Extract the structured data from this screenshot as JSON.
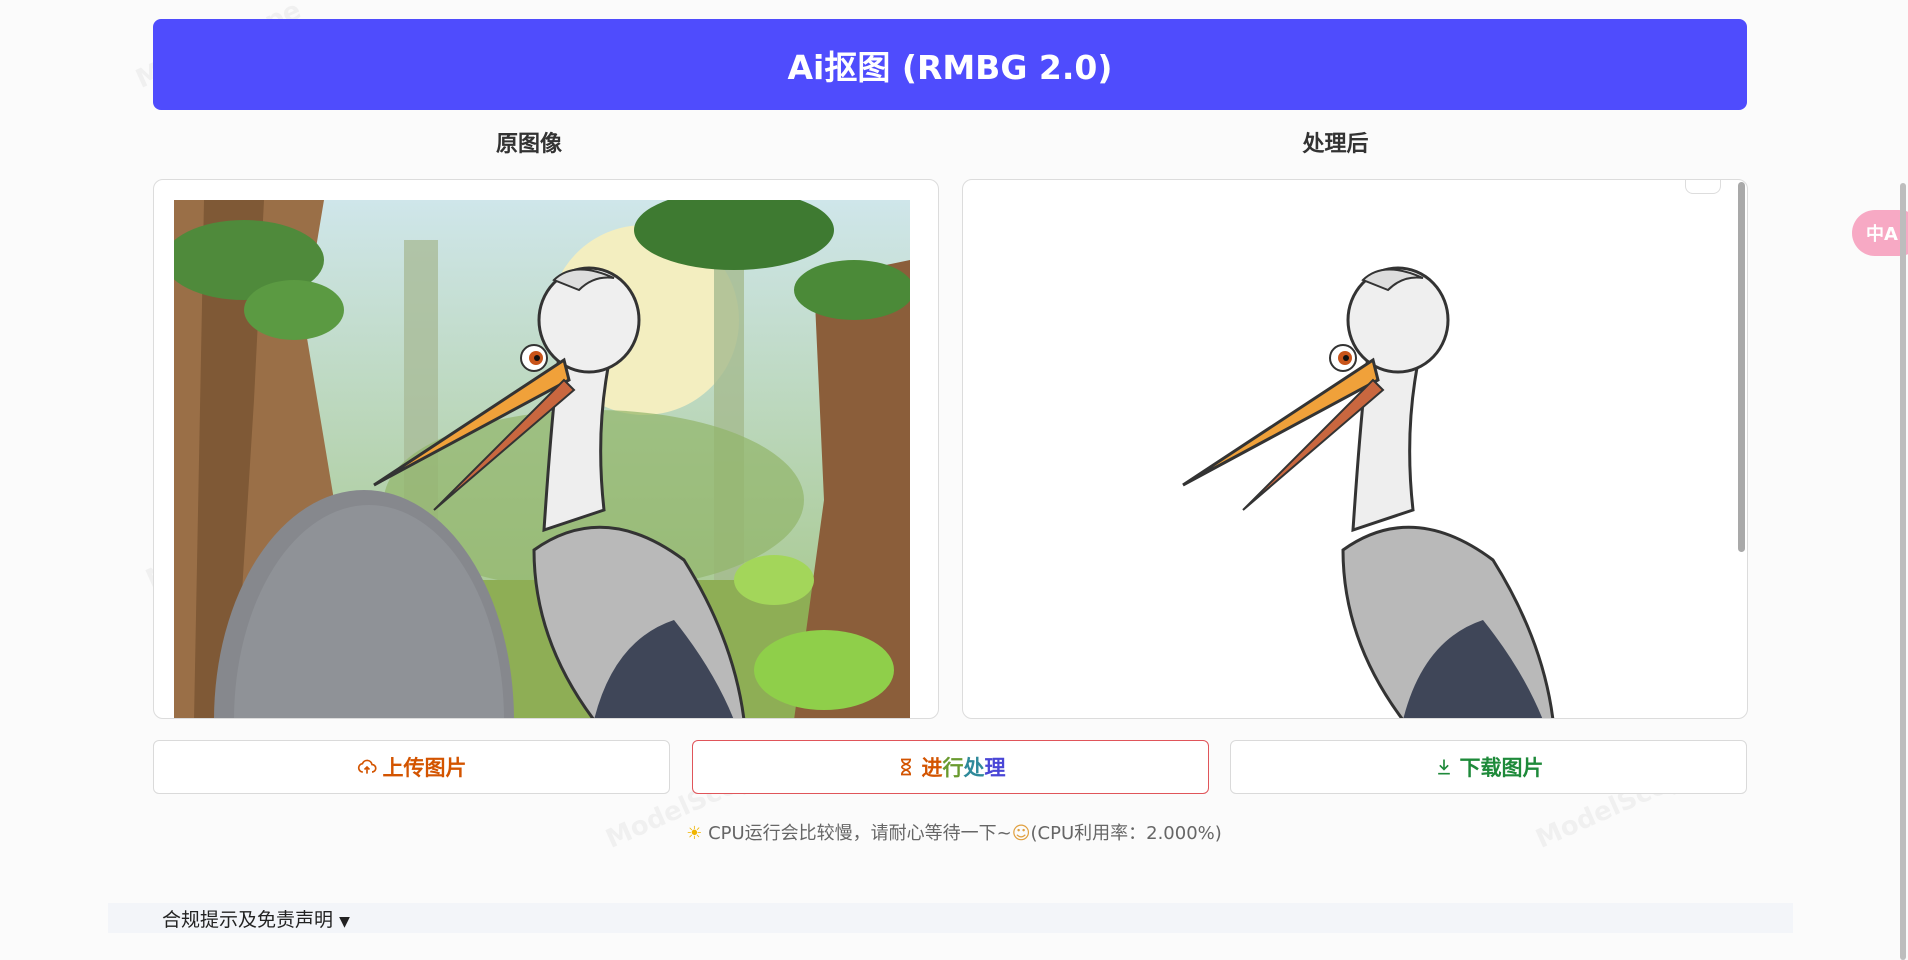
{
  "header": {
    "title": "Ai抠图 (RMBG 2.0)"
  },
  "columns": {
    "original_label": "原图像",
    "processed_label": "处理后"
  },
  "buttons": {
    "upload_label": "上传图片",
    "process_part1": "进",
    "process_part2": "行",
    "process_part3": "处",
    "process_part4": "理",
    "download_label": "下载图片"
  },
  "notice": {
    "text": "CPU运行会比较慢，请耐心等待一下~",
    "usage": "(CPU利用率：2.000%)"
  },
  "footer": {
    "disclaimer_label": "合规提示及免责声明"
  },
  "translate_fab": {
    "label": "中A"
  },
  "watermark": {
    "text": "ModelScope"
  },
  "colors": {
    "title_bg": "#4f4cfd",
    "upload": "#d35400",
    "download": "#1e8a3a",
    "process_border": "#e0555a"
  }
}
